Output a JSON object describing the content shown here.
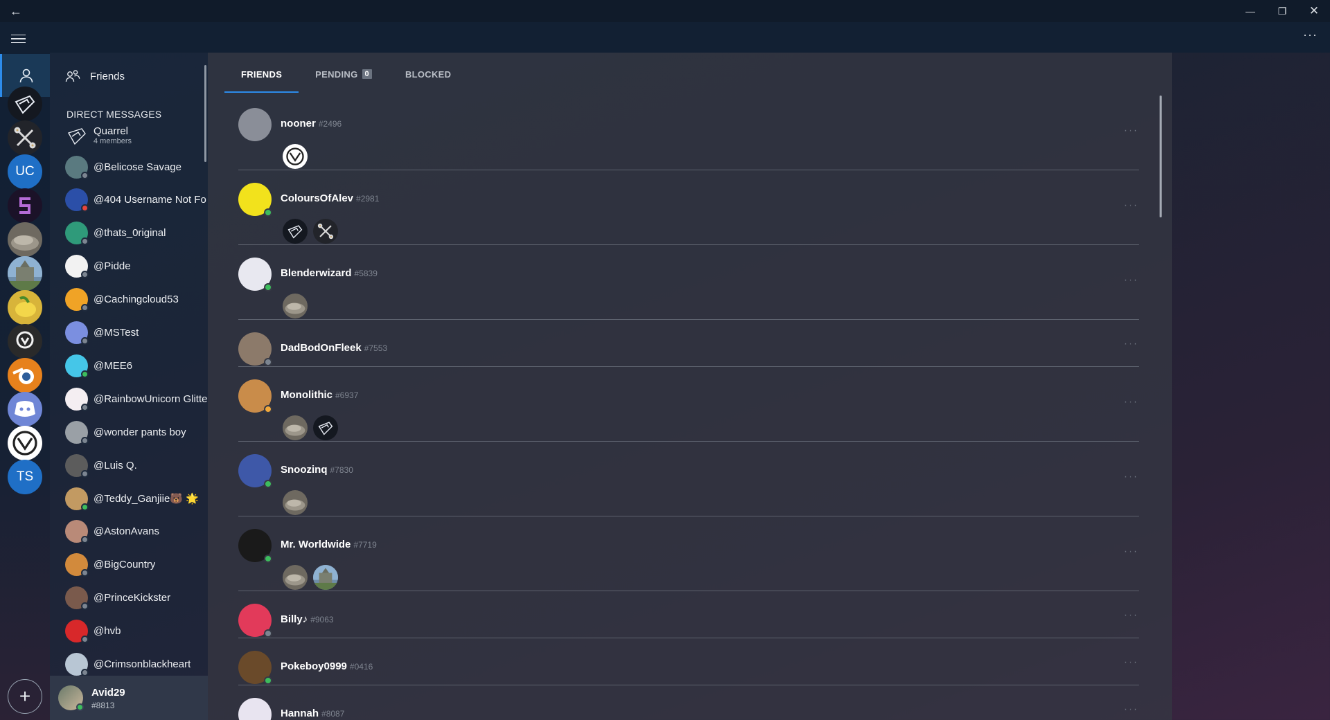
{
  "titlebar": {
    "back": "←",
    "minimize": "—",
    "restore": "❐",
    "close": "✕",
    "more": "···"
  },
  "servers": [
    {
      "label": "",
      "icon": "quarrel-server-icon",
      "bg": "#141820"
    },
    {
      "label": "",
      "icon": "crossed-swords-server-icon",
      "bg": "#22242a"
    },
    {
      "label": "UC",
      "icon": "",
      "bg": "#1f6fc6"
    },
    {
      "label": "",
      "icon": "s-logo-server-icon",
      "bg": "#1b1228"
    },
    {
      "label": "",
      "icon": "rock-server-icon",
      "bg": "#6e6960"
    },
    {
      "label": "",
      "icon": "building-server-icon",
      "bg": "#6f8eaa"
    },
    {
      "label": "",
      "icon": "lemon-server-icon",
      "bg": "#d8b43a"
    },
    {
      "label": "",
      "icon": "overwatch-server-icon",
      "bg": "#2a2a2a"
    },
    {
      "label": "",
      "icon": "blender-server-icon",
      "bg": "#e7811c"
    },
    {
      "label": "",
      "icon": "discord-api-server-icon",
      "bg": "#6f86d6"
    },
    {
      "label": "",
      "icon": "vlogo-server-icon",
      "bg": "#ffffff"
    },
    {
      "label": "TS",
      "icon": "",
      "bg": "#1f6fc6"
    }
  ],
  "add_server": "+",
  "sidebar": {
    "friends_label": "Friends",
    "dm_header": "DIRECT MESSAGES",
    "group": {
      "name": "Quarrel",
      "sub": "4 members"
    },
    "dms": [
      {
        "name": "@Belicose Savage",
        "status": "offline",
        "color": "#5a7a80"
      },
      {
        "name": "@404 Username Not Fo",
        "status": "dnd",
        "color": "#2b4fa8"
      },
      {
        "name": "@thats_0riginal",
        "status": "offline",
        "color": "#2f9a7a"
      },
      {
        "name": "@Pidde",
        "status": "offline",
        "color": "#f2f2f2"
      },
      {
        "name": "@Cachingcloud53",
        "status": "offline",
        "color": "#f0a326"
      },
      {
        "name": "@MSTest",
        "status": "offline",
        "color": "#7b8fe0"
      },
      {
        "name": "@MEE6",
        "status": "online",
        "color": "#45c6e8"
      },
      {
        "name": "@RainbowUnicorn Glitte",
        "status": "offline",
        "color": "#f4eef2"
      },
      {
        "name": "@wonder pants boy",
        "status": "offline",
        "color": "#9aa0a6"
      },
      {
        "name": "@Luis Q.",
        "status": "offline",
        "color": "#5c5c5c"
      },
      {
        "name": "@Teddy_Ganjiie🐻 🌟",
        "status": "online",
        "color": "#c29a62"
      },
      {
        "name": "@AstonAvans",
        "status": "offline",
        "color": "#b98a78"
      },
      {
        "name": "@BigCountry",
        "status": "offline",
        "color": "#d28a3c"
      },
      {
        "name": "@PrinceKickster",
        "status": "offline",
        "color": "#7a5a4c"
      },
      {
        "name": "@hvb",
        "status": "offline",
        "color": "#d8282a"
      },
      {
        "name": "@Crimsonblackheart",
        "status": "offline",
        "color": "#b8c6d4"
      }
    ]
  },
  "user": {
    "name": "Avid29",
    "tag": "#8813",
    "status": "online"
  },
  "tabs": [
    {
      "label": "FRIENDS",
      "count": null
    },
    {
      "label": "PENDING",
      "count": "0"
    },
    {
      "label": "BLOCKED",
      "count": null
    }
  ],
  "friends": [
    {
      "name": "nooner",
      "disc": "#2496",
      "status": "none",
      "avatar": "#8a8e98",
      "mutuals": [
        "vlogo-server-icon"
      ]
    },
    {
      "name": "ColoursOfAlev",
      "disc": "#2981",
      "status": "online",
      "avatar": "#f2e21c",
      "mutuals": [
        "quarrel-server-icon",
        "crossed-swords-server-icon"
      ]
    },
    {
      "name": "Blenderwizard",
      "disc": "#5839",
      "status": "online",
      "avatar": "#e8e8f0",
      "mutuals": [
        "rock-server-icon"
      ]
    },
    {
      "name": "DadBodOnFleek",
      "disc": "#7553",
      "status": "offline",
      "avatar": "#8c7a6a",
      "mutuals": []
    },
    {
      "name": "Monolithic",
      "disc": "#6937",
      "status": "idle",
      "avatar": "#c98c4a",
      "mutuals": [
        "rock-server-icon",
        "quarrel-server-icon"
      ]
    },
    {
      "name": "Snoozinq",
      "disc": "#7830",
      "status": "online",
      "avatar": "#3e58a8",
      "mutuals": [
        "rock-server-icon"
      ]
    },
    {
      "name": "Mr. Worldwide",
      "disc": "#7719",
      "status": "online",
      "avatar": "#1a1a1a",
      "mutuals": [
        "rock-server-icon",
        "building-server-icon"
      ]
    },
    {
      "name": "Billy♪",
      "disc": "#9063",
      "status": "offline",
      "avatar": "#e23a5a",
      "mutuals": []
    },
    {
      "name": "Pokeboy0999",
      "disc": "#0416",
      "status": "online",
      "avatar": "#6a4a2a",
      "mutuals": []
    },
    {
      "name": "Hannah",
      "disc": "#8087",
      "status": "offline",
      "avatar": "#e8e4f0",
      "mutuals": []
    }
  ],
  "row_more": "···"
}
